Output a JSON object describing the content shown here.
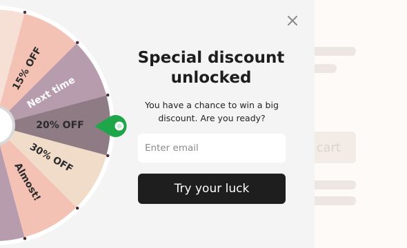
{
  "background": {
    "cart_label": "cart"
  },
  "popup": {
    "title_line1": "Special discount",
    "title_line2": "unlocked",
    "subtitle_line1": "You have a chance to win a big",
    "subtitle_line2": "discount. Are you ready?",
    "email_placeholder": "Enter email",
    "email_value": "",
    "cta_label": "Try your luck",
    "close_icon": "close-icon"
  },
  "wheel": {
    "slices": [
      {
        "label": "",
        "color": "#f6e0d6",
        "text_color": "#2b2b2b"
      },
      {
        "label": "15% OFF",
        "color": "#f4c2b4",
        "text_color": "#2b2b2b"
      },
      {
        "label": "Next time",
        "color": "#b79cae",
        "text_color": "#ffffff"
      },
      {
        "label": "20% OFF",
        "color": "#8e7b83",
        "text_color": "#2b2b2b"
      },
      {
        "label": "30% OFF",
        "color": "#f1dcc9",
        "text_color": "#2b2b2b"
      },
      {
        "label": "Almost!",
        "color": "#f4c2b4",
        "text_color": "#2b2b2b"
      },
      {
        "label": "",
        "color": "#b79cae",
        "text_color": "#2b2b2b"
      }
    ],
    "pointer_color": "#1fa64a",
    "rim_color": "#ffffff",
    "dot_color": "#4a2b36"
  }
}
